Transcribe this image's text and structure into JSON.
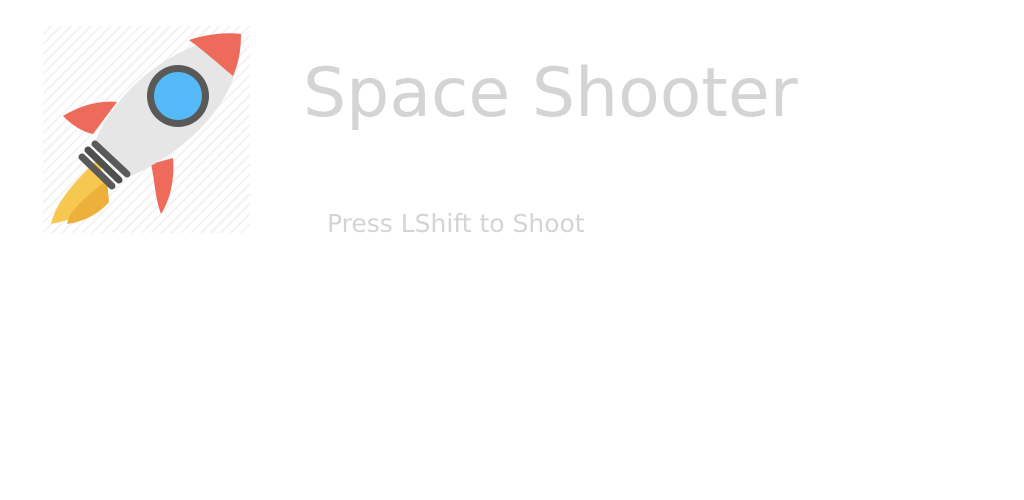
{
  "game": {
    "title": "Space Shooter",
    "instruction": "Press LShift to Shoot"
  },
  "logo": {
    "icon": "rocket-icon"
  },
  "colors": {
    "background": "#ffffff",
    "text": "#d4d4d4",
    "rocket_body": "#e6e6e6",
    "rocket_fins": "#ee6b5b",
    "window_frame": "#595959",
    "window_glass": "#56b9f7",
    "flame": "#f6c84f"
  }
}
